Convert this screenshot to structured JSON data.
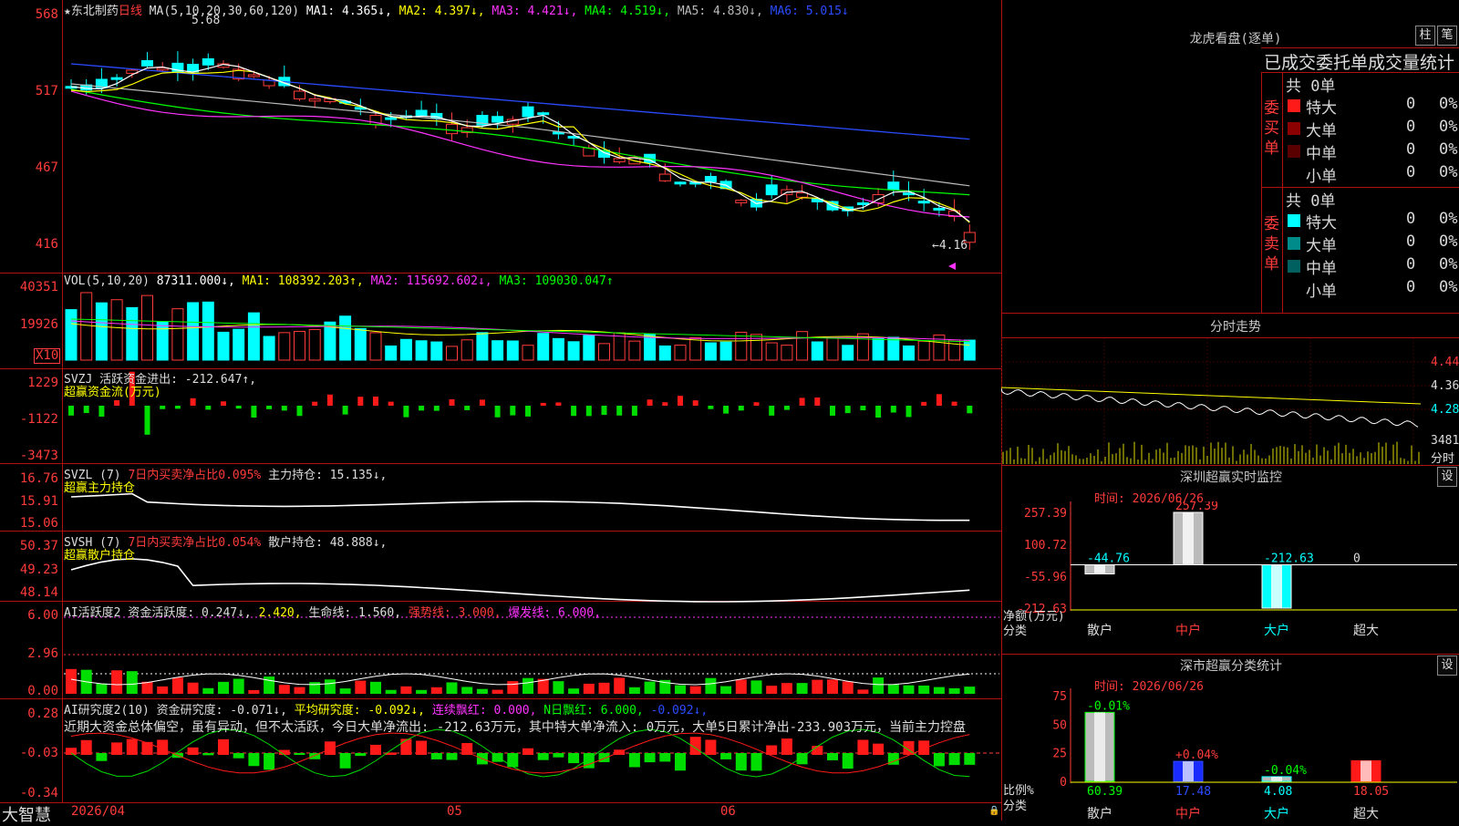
{
  "stock": {
    "name": "★东北制药",
    "period": "日线",
    "ma_text": "MA(5,10,20,30,60,120)",
    "ma1": "MA1: 4.365↓,",
    "ma2": "MA2: 4.397↓,",
    "ma3": "MA3: 4.421↓,",
    "ma4": "MA4: 4.519↓,",
    "ma5": "MA5: 4.830↓,",
    "ma6": "MA6: 5.015↓",
    "high_mark": "5.68",
    "low_mark": "←4.16",
    "price_axis": [
      "568",
      "517",
      "467",
      "416"
    ]
  },
  "vol": {
    "title": "VOL(5,10,20)",
    "value": "87311.000↓,",
    "ma1": "MA1: 108392.203↑,",
    "ma2": "MA2: 115692.602↓,",
    "ma3": "MA3: 109030.047↑",
    "axis": [
      "40351",
      "19926",
      "X10"
    ]
  },
  "svzj": {
    "line1": "SVZJ  活跃资金进出: -212.647↑,",
    "line2": "超赢资金流(万元)",
    "axis": [
      "1229",
      "-1122",
      "-3473"
    ]
  },
  "svzl": {
    "title": "SVZL (7)",
    "ratio": "7日内买卖净占比0.095%",
    "hold": "主力持仓: 15.135↓,",
    "sub": "超赢主力持仓",
    "axis": [
      "16.76",
      "15.91",
      "15.06"
    ]
  },
  "svsh": {
    "title": "SVSH (7)",
    "ratio": "7日内买卖净占比0.054%",
    "hold": "散户持仓: 48.888↓,",
    "sub": "超赢散户持仓",
    "axis": [
      "50.37",
      "49.23",
      "48.14"
    ]
  },
  "ai1": {
    "title": "AI活跃度2",
    "v1": "资金活跃度: 0.247↓,",
    "v2": "2.420,",
    "v3": "生命线: 1.560,",
    "v4": "强势线: 3.000,",
    "v5": "爆发线: 6.000,",
    "axis": [
      "6.00",
      "2.96",
      "0.00"
    ]
  },
  "ai2": {
    "title": "AI研究度2(10)",
    "v1": "资金研究度: -0.071↓,",
    "v2": "平均研究度: -0.092↓,",
    "v3": "连续飘红: 0.000,",
    "v4": "N日飘红: 6.000,",
    "v5": "-0.092↓,",
    "note": "近期大资金总体偏空，虽有异动，但不太活跃，今日大单净流出: -212.63万元，其中特大单净流入: 0万元，大单5日累计净出-233.903万元，当前主力控盘",
    "axis": [
      "0.28",
      "-0.03",
      "-0.34"
    ]
  },
  "footer": {
    "brand": "大智慧",
    "dates": [
      "2026/04",
      "05",
      "06"
    ]
  },
  "right": {
    "dragon_title": "龙虎看盘(逐单)",
    "btn_bar": "柱",
    "btn_tick": "笔",
    "stats_title": "已成交委托单成交量统计",
    "buy_label": "委买单",
    "sell_label": "委卖单",
    "buy_total": "共 0单",
    "sell_total": "共 0单",
    "buy_rows": [
      {
        "name": "特大",
        "count": "0",
        "pct": "0%",
        "color": "#ff1a1a"
      },
      {
        "name": "大单",
        "count": "0",
        "pct": "0%",
        "color": "#8b0000"
      },
      {
        "name": "中单",
        "count": "0",
        "pct": "0%",
        "color": "#5a0000"
      },
      {
        "name": "小单",
        "count": "0",
        "pct": "0%",
        "color": "#000000"
      }
    ],
    "sell_rows": [
      {
        "name": "特大",
        "count": "0",
        "pct": "0%",
        "color": "#00ffff"
      },
      {
        "name": "大单",
        "count": "0",
        "pct": "0%",
        "color": "#008b8b"
      },
      {
        "name": "中单",
        "count": "0",
        "pct": "0%",
        "color": "#006060"
      },
      {
        "name": "小单",
        "count": "0",
        "pct": "0%",
        "color": "#000000"
      }
    ],
    "minute_title": "分时走势",
    "minute_axis": [
      "4.440",
      "4.360",
      "4.280",
      "3481",
      "分时"
    ],
    "sz_title": "深圳超赢实时监控",
    "sz_btn": "设",
    "sz_time": "时间: 2026/06/26",
    "sz_axis": [
      "257.39",
      "100.72",
      "-55.96",
      "-212.63"
    ],
    "sz_values": [
      "-44.76",
      "257.39",
      "-212.63",
      "0"
    ],
    "sz_y_label": "净额(万元)",
    "sz_x_label": "分类",
    "categories": [
      "散户",
      "中户",
      "大户",
      "超大"
    ],
    "cls_title": "深市超赢分类统计",
    "cls_btn": "设",
    "cls_time": "时间: 2026/06/26",
    "cls_axis": [
      "75",
      "50",
      "25",
      "0"
    ],
    "cls_changes": [
      "-0.01%",
      "+0.04%",
      "-0.04%"
    ],
    "cls_values": [
      "60.39",
      "17.48",
      "4.08",
      "18.05"
    ],
    "cls_y_label": "比例%",
    "cls_x_label": "分类"
  },
  "chart_data": [
    {
      "type": "bar",
      "title": "深圳超赢实时监控",
      "ylabel": "净额(万元)",
      "xlabel": "分类",
      "categories": [
        "散户",
        "中户",
        "大户",
        "超大"
      ],
      "values": [
        -44.76,
        257.39,
        -212.63,
        0
      ],
      "ylim": [
        -212.63,
        257.39
      ]
    },
    {
      "type": "bar",
      "title": "深市超赢分类统计",
      "ylabel": "比例%",
      "xlabel": "分类",
      "categories": [
        "散户",
        "中户",
        "大户",
        "超大"
      ],
      "values": [
        60.39,
        17.48,
        4.08,
        18.05
      ],
      "ylim": [
        0,
        75
      ]
    }
  ]
}
